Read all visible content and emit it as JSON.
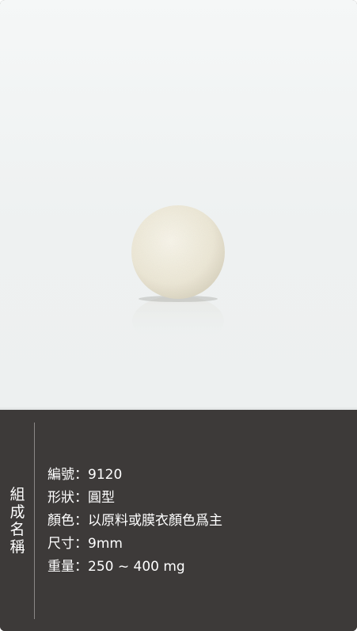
{
  "panel_title": [
    "組",
    "成",
    "名",
    "稱"
  ],
  "specs": [
    {
      "label": "編號",
      "sep": "：",
      "value": "9120"
    },
    {
      "label": "形狀",
      "sep": "：",
      "value": "圓型"
    },
    {
      "label": "顏色",
      "sep": "：",
      "value": "以原料或膜衣顏色爲主"
    },
    {
      "label": "尺寸",
      "sep": "：",
      "value": "9mm"
    },
    {
      "label": "重量",
      "sep": "：",
      "value": "250 ~ 400 mg"
    }
  ],
  "colors": {
    "panel_bg": "#3d3a39",
    "photo_bg": "#f0f3f3",
    "pill": "#efebdc",
    "text": "#ffffff"
  }
}
